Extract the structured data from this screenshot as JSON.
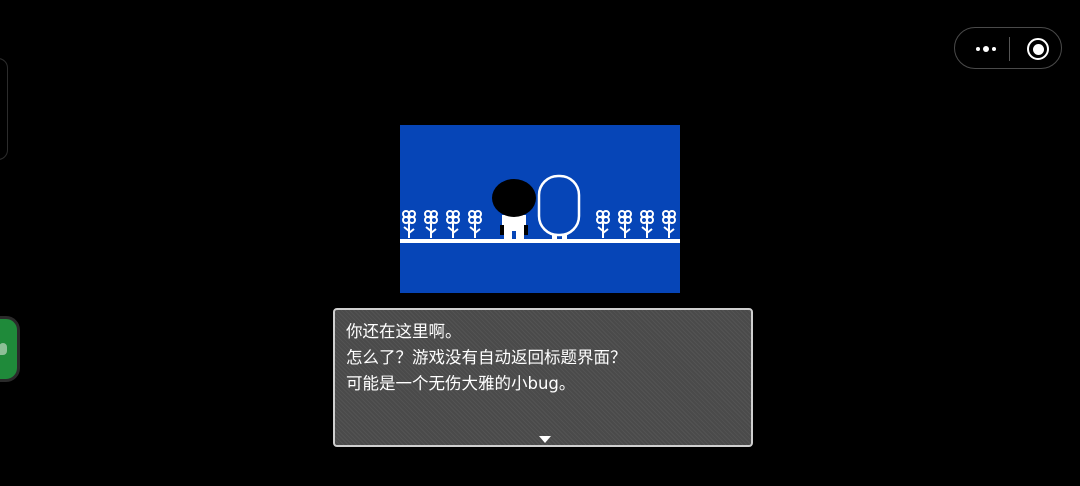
{
  "capsule": {
    "more_icon": "more-dots-icon",
    "close_icon": "target-close-icon"
  },
  "scene": {
    "background_color": "#0645b7",
    "figure_color": "#000000",
    "outline_color": "#ffffff"
  },
  "dialog": {
    "lines": [
      "你还在这里啊。",
      "怎么了？游戏没有自动返回标题界面？",
      "可能是一个无伤大雅的小bug。"
    ],
    "advance_icon": "triangle-down-icon"
  }
}
